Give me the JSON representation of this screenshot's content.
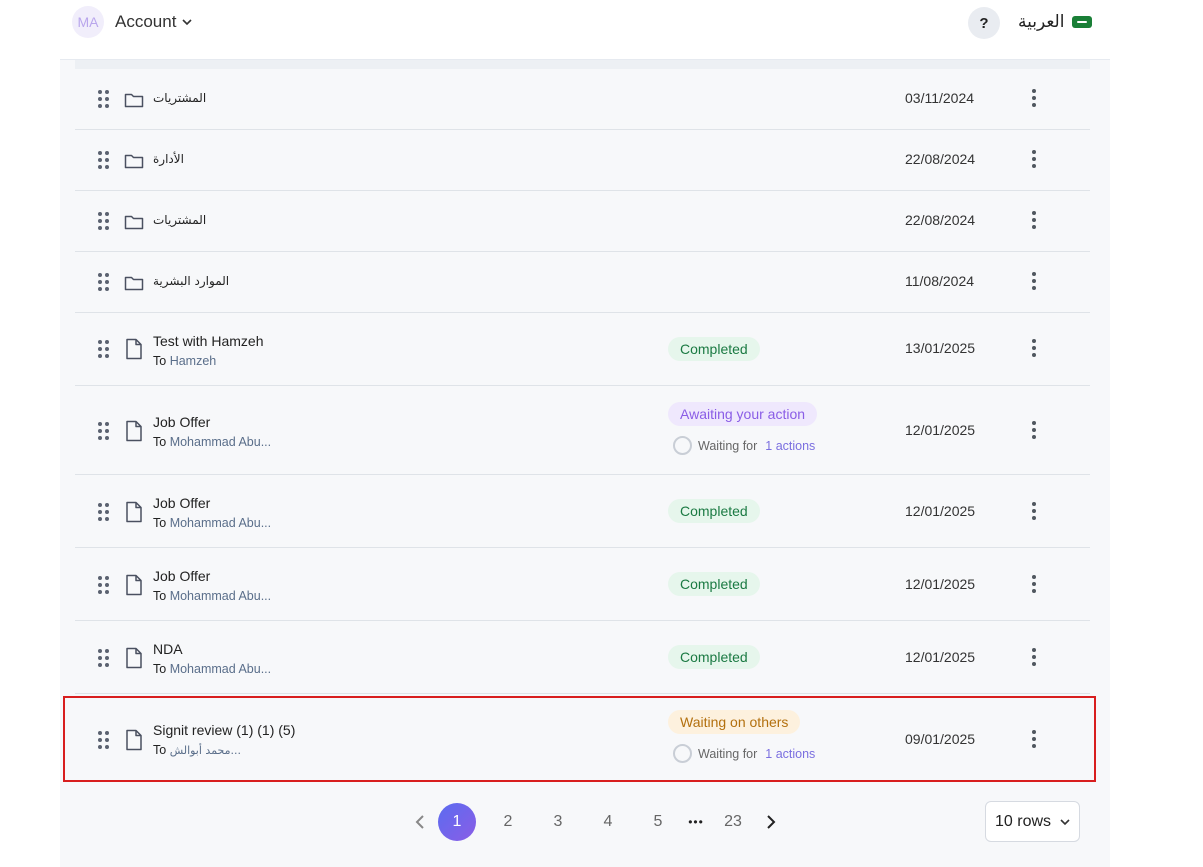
{
  "header": {
    "avatar_initials": "MA",
    "account_label": "Account",
    "help_label": "?",
    "language_label": "العربية"
  },
  "rows": [
    {
      "type": "folder",
      "name": "المشتريات",
      "date": "03/11/2024"
    },
    {
      "type": "folder",
      "name": "الأدارة",
      "date": "22/08/2024"
    },
    {
      "type": "folder",
      "name": "المشتريات",
      "date": "22/08/2024"
    },
    {
      "type": "folder",
      "name": "الموارد البشرية",
      "date": "11/08/2024"
    },
    {
      "type": "document",
      "name": "Test with Hamzeh",
      "to_label": "To",
      "recipient": "Hamzeh",
      "status": "Completed",
      "date": "13/01/2025"
    },
    {
      "type": "document",
      "name": "Job Offer",
      "to_label": "To",
      "recipient": "Mohammad Abu...",
      "status": "Awaiting your action",
      "waiting_for": "Waiting for",
      "actions": "1 actions",
      "date": "12/01/2025"
    },
    {
      "type": "document",
      "name": "Job Offer",
      "to_label": "To",
      "recipient": "Mohammad Abu...",
      "status": "Completed",
      "date": "12/01/2025"
    },
    {
      "type": "document",
      "name": "Job Offer",
      "to_label": "To",
      "recipient": "Mohammad Abu...",
      "status": "Completed",
      "date": "12/01/2025"
    },
    {
      "type": "document",
      "name": "NDA",
      "to_label": "To",
      "recipient": "Mohammad Abu...",
      "status": "Completed",
      "date": "12/01/2025"
    },
    {
      "type": "document",
      "name": "Signit review (1) (1) (5)",
      "to_label": "To",
      "recipient": "محمد أبوالش...",
      "status": "Waiting on others",
      "waiting_for": "Waiting for",
      "actions": "1 actions",
      "date": "09/01/2025"
    }
  ],
  "pagination": {
    "pages": [
      "1",
      "2",
      "3",
      "4",
      "5"
    ],
    "ellipsis": "•••",
    "last_page": "23",
    "current_page": "1",
    "rows_per_page": "10 rows"
  },
  "colors": {
    "completed": "#1b7a43",
    "awaiting": "#8a5de6",
    "waiting": "#b3700e",
    "highlight": "#d81e1e"
  }
}
